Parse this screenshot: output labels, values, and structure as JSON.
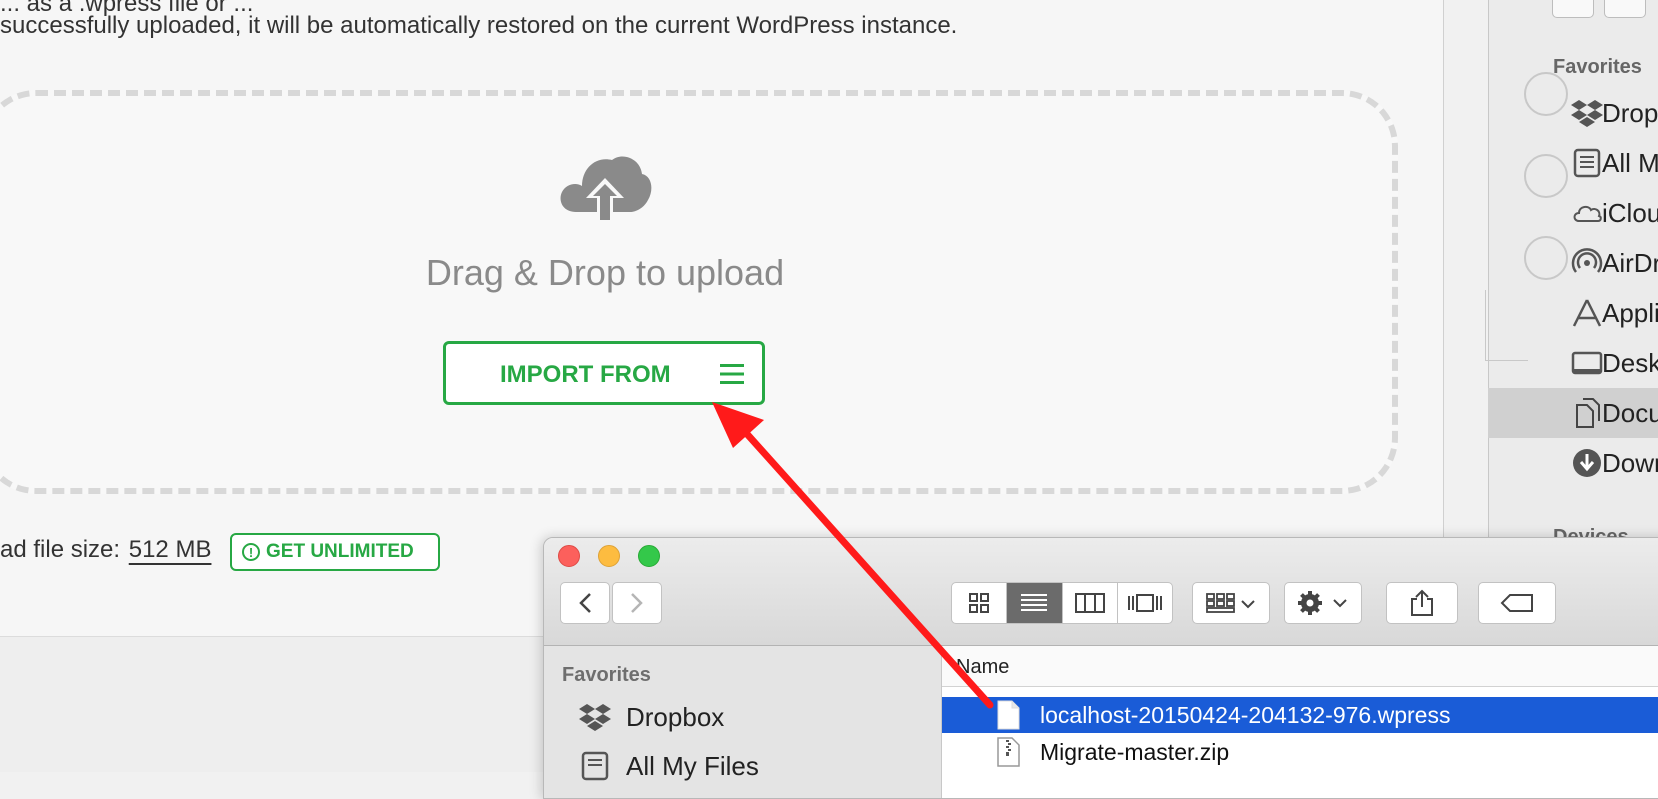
{
  "wordpress": {
    "top_partial_text": "... as a .wpress file or ...",
    "description": "successfully uploaded, it will be automatically restored on the current WordPress instance.",
    "drop_text": "Drag & Drop to upload",
    "import_button_label": "IMPORT FROM",
    "max_size_label": "ad file size:",
    "max_size_value": "512 MB",
    "get_unlimited_label": "GET UNLIMITED"
  },
  "background_finder": {
    "favorites_label": "Favorites",
    "items": [
      {
        "label": "Dropbox",
        "icon": "dropbox-icon"
      },
      {
        "label": "All My Files",
        "icon": "all-files-icon"
      },
      {
        "label": "iCloud Drive",
        "icon": "icloud-icon"
      },
      {
        "label": "AirDrop",
        "icon": "airdrop-icon"
      },
      {
        "label": "Applications",
        "icon": "applications-icon"
      },
      {
        "label": "Desktop",
        "icon": "desktop-icon"
      },
      {
        "label": "Documents",
        "icon": "documents-icon",
        "selected": true
      },
      {
        "label": "Downloads",
        "icon": "downloads-icon"
      }
    ],
    "devices_label": "Devices"
  },
  "finder": {
    "favorites_label": "Favorites",
    "sidebar_items": [
      {
        "label": "Dropbox",
        "icon": "dropbox-icon"
      },
      {
        "label": "All My Files",
        "icon": "all-files-icon"
      }
    ],
    "column_name": "Name",
    "files": [
      {
        "name": "localhost-20150424-204132-976.wpress",
        "selected": true,
        "icon": "document-icon"
      },
      {
        "name": "Migrate-master.zip",
        "selected": false,
        "icon": "zip-icon"
      }
    ],
    "view_mode": "list"
  },
  "colors": {
    "accent_green": "#27a844",
    "selection_blue": "#1a5cd7",
    "arrow_red": "#ff1a1a"
  }
}
